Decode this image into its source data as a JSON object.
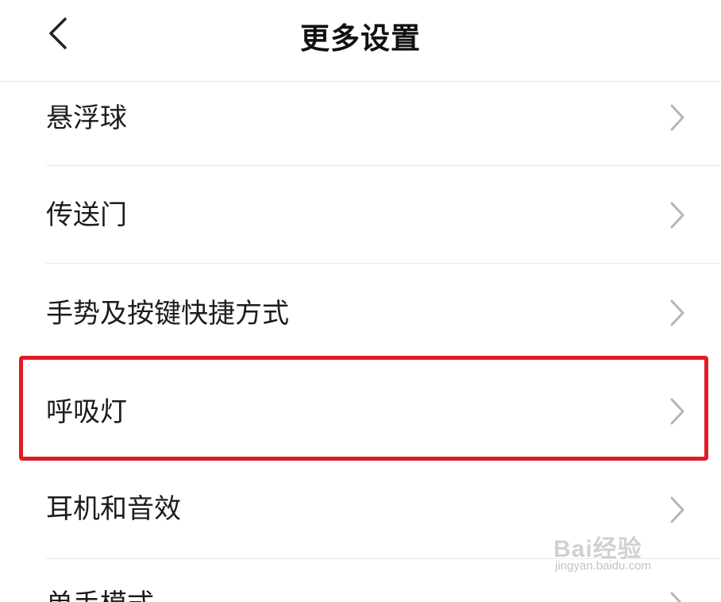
{
  "header": {
    "title": "更多设置",
    "back_icon": "chevron-left-icon"
  },
  "rows": [
    {
      "label": "悬浮球",
      "icon": "chevron-right-icon"
    },
    {
      "label": "传送门",
      "icon": "chevron-right-icon"
    },
    {
      "label": "手势及按键快捷方式",
      "icon": "chevron-right-icon"
    },
    {
      "label": "呼吸灯",
      "icon": "chevron-right-icon",
      "highlighted": true
    },
    {
      "label": "耳机和音效",
      "icon": "chevron-right-icon"
    },
    {
      "label": "单手模式",
      "icon": "chevron-right-icon"
    }
  ],
  "highlight_color": "#e01b25",
  "watermark": {
    "logo": "Bai经验",
    "url": "jingyan.baidu.com"
  }
}
